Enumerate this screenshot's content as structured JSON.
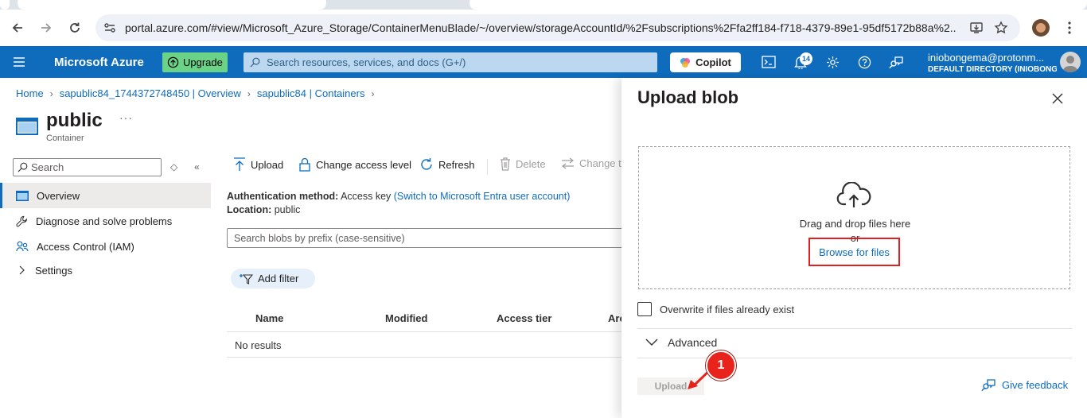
{
  "browser": {
    "url": "portal.azure.com/#view/Microsoft_Azure_Storage/ContainerMenuBlade/~/overview/storageAccountId/%2Fsubscriptions%2Ffa2ff184-f718-4379-89e1-95df5172b88a%2..."
  },
  "header": {
    "brand": "Microsoft Azure",
    "upgrade_label": "Upgrade",
    "search_placeholder": "Search resources, services, and docs (G+/)",
    "copilot_label": "Copilot",
    "notification_count": "14",
    "account_email": "iniobongema@protonm...",
    "account_directory": "DEFAULT DIRECTORY (INIOBONG..."
  },
  "breadcrumb": [
    "Home",
    "sapublic84_1744372748450 | Overview",
    "sapublic84 | Containers"
  ],
  "page": {
    "title": "public",
    "subtitle": "Container",
    "more": "···"
  },
  "nav": {
    "search_placeholder": "Search",
    "items": [
      {
        "label": "Overview",
        "icon": "container-icon"
      },
      {
        "label": "Diagnose and solve problems",
        "icon": "wrench-icon"
      },
      {
        "label": "Access Control (IAM)",
        "icon": "people-icon"
      },
      {
        "label": "Settings",
        "icon": "chevron-right-icon"
      }
    ]
  },
  "commands": {
    "upload": "Upload",
    "change_access": "Change access level",
    "refresh": "Refresh",
    "delete": "Delete",
    "change_tier": "Change t"
  },
  "info": {
    "auth_label": "Authentication method:",
    "auth_value": "Access key",
    "auth_link": "(Switch to Microsoft Entra user account)",
    "location_label": "Location:",
    "location_value": "public"
  },
  "blob_search_placeholder": "Search blobs by prefix (case-sensitive)",
  "add_filter": "Add filter",
  "table": {
    "columns": [
      "Name",
      "Modified",
      "Access tier",
      "Arc"
    ],
    "empty_text": "No results"
  },
  "blade": {
    "title": "Upload blob",
    "drop_text": "Drag and drop files here",
    "or_text": "or",
    "browse_label": "Browse for files",
    "overwrite_label": "Overwrite if files already exist",
    "advanced_label": "Advanced",
    "upload_button": "Upload",
    "feedback_label": "Give feedback"
  },
  "annotation": {
    "step": "1",
    "color": "#e8231c"
  },
  "colors": {
    "azure_blue": "#0f6cbd",
    "upgrade_green": "#6bd387",
    "highlight_red": "#e0201f"
  }
}
